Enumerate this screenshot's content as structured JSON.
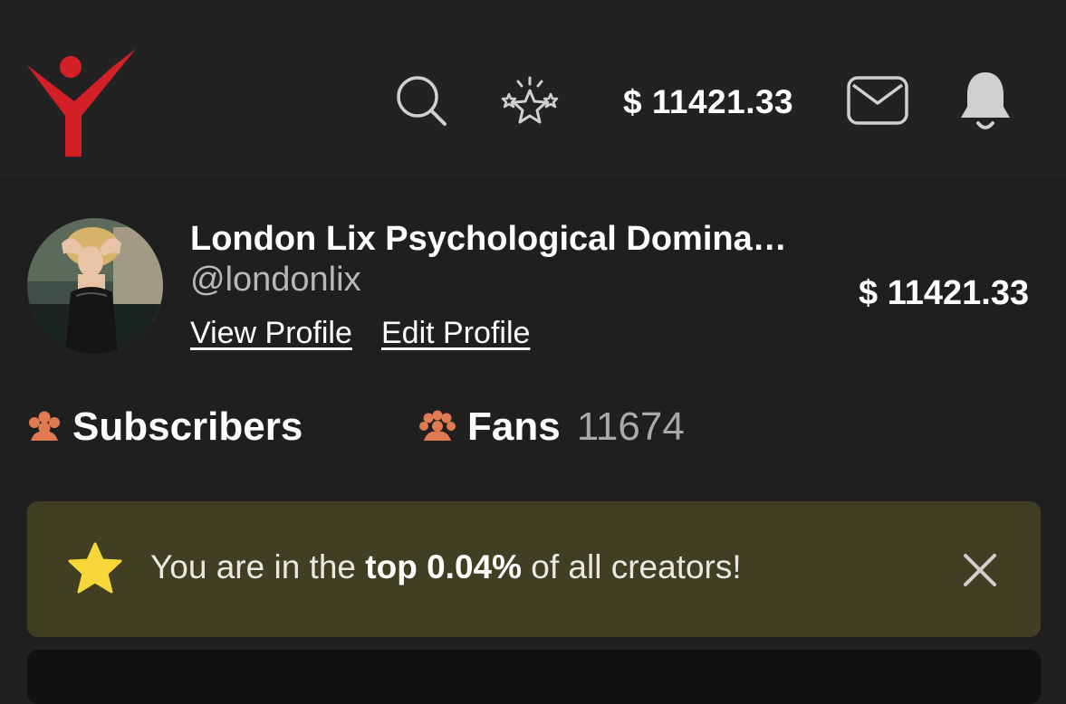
{
  "header": {
    "balance": "$ 11421.33",
    "icons": [
      "app-logo",
      "search-icon",
      "stars-icon",
      "mail-icon",
      "bell-icon"
    ]
  },
  "profile": {
    "name": "London Lix Psychological Domina…",
    "handle": "@londonlix",
    "view_profile_label": "View Profile",
    "edit_profile_label": "Edit Profile",
    "balance": "$ 11421.33"
  },
  "stats": {
    "subscribers_label": "Subscribers",
    "fans_label": "Fans",
    "fans_count": "11674"
  },
  "banner": {
    "text_before": "You are in the ",
    "text_bold": "top 0.04%",
    "text_after": " of all creators!"
  },
  "colors": {
    "background": "#1f1f1f",
    "header_background": "#222222",
    "logo_red": "#d32027",
    "stat_icon": "#e07a50",
    "banner_background": "#413f23",
    "star_yellow": "#f7d63a"
  }
}
